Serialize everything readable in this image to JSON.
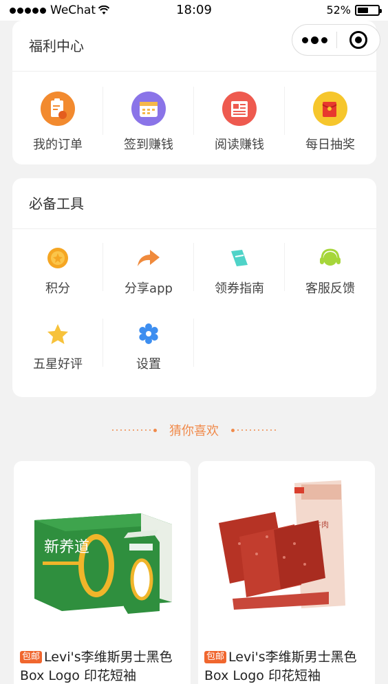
{
  "status_bar": {
    "carrier": "WeChat",
    "time": "18:09",
    "battery": "52%",
    "battery_level": 0.52
  },
  "welfare": {
    "title": "福利中心",
    "items": [
      {
        "label": "我的订单",
        "icon": "order-clipboard-icon",
        "color": "#f28a2f"
      },
      {
        "label": "签到赚钱",
        "icon": "calendar-checkin-icon",
        "color": "#8a74e8"
      },
      {
        "label": "阅读赚钱",
        "icon": "newspaper-icon",
        "color": "#ee5a4f"
      },
      {
        "label": "每日抽奖",
        "icon": "red-envelope-icon",
        "color": "#f6c62c"
      }
    ]
  },
  "tools": {
    "title": "必备工具",
    "items": [
      {
        "label": "积分",
        "icon": "points-coin-icon",
        "color": "#f5a623"
      },
      {
        "label": "分享app",
        "icon": "share-arrow-icon",
        "color": "#f08a3c"
      },
      {
        "label": "领券指南",
        "icon": "coupon-icon",
        "color": "#4fd3c8"
      },
      {
        "label": "客服反馈",
        "icon": "headset-icon",
        "color": "#a6d63a"
      },
      {
        "label": "五星好评",
        "icon": "star-icon",
        "color": "#f7c23b"
      },
      {
        "label": "设置",
        "icon": "gear-icon",
        "color": "#3d8ef0"
      }
    ]
  },
  "recommend": {
    "title": "猜你喜欢"
  },
  "products": [
    {
      "tag": "包邮",
      "name": "Levi's李维斯男士黑色Box Logo 印花短袖",
      "image": "milk-box-image"
    },
    {
      "tag": "包邮",
      "name": "Levi's李维斯男士黑色Box Logo 印花短袖",
      "image": "jerky-image"
    }
  ]
}
